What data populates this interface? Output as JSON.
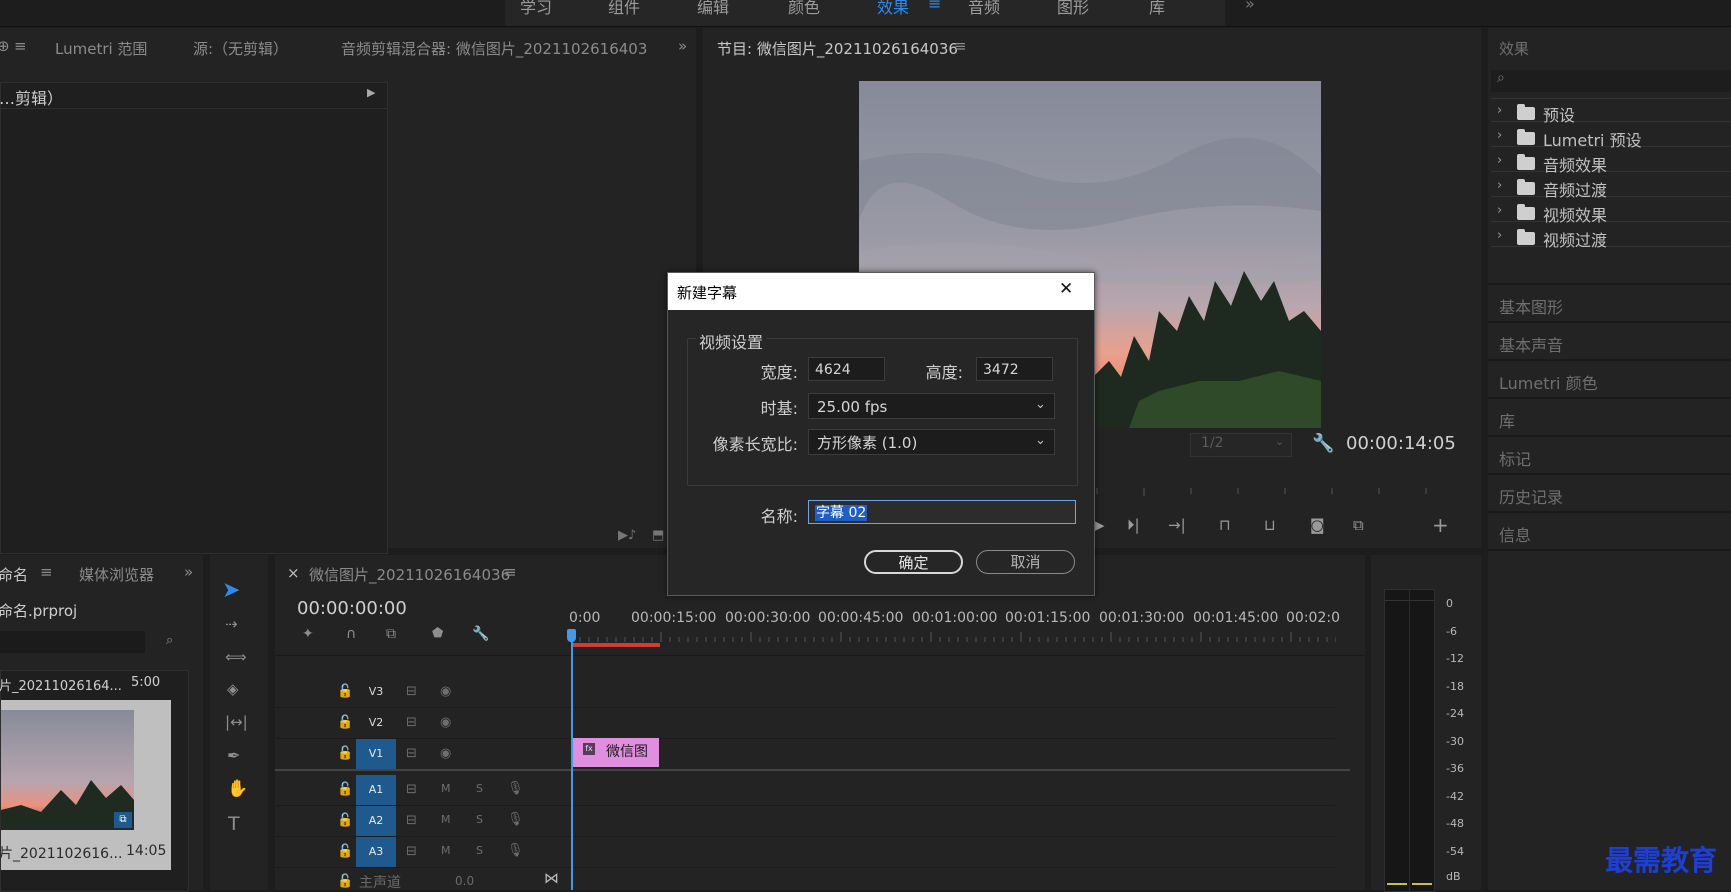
{
  "workspace_tabs": [
    "学习",
    "组件",
    "编辑",
    "颜色",
    "效果",
    "音频",
    "图形",
    "库"
  ],
  "active_workspace": "效果",
  "menu_glyph": "≡",
  "more_glyph": "»",
  "source_panel": {
    "tabs": [
      "Lumetri 范围",
      "源:（无剪辑）",
      "音频剪辑混合器: 微信图片_2021102616403"
    ],
    "left_fragment": "（无剪辑）",
    "effect_controls_fragment": "…剪辑）"
  },
  "program_panel": {
    "title": "节目: 微信图片_20211026164036",
    "zoom": "1/2",
    "timecode": "00:00:14:05"
  },
  "effects_panel": {
    "title": "效果",
    "items": [
      "预设",
      "Lumetri 预设",
      "音频效果",
      "音频过渡",
      "视频效果",
      "视频过渡"
    ],
    "side_panels": [
      "基本图形",
      "基本声音",
      "Lumetri 颜色",
      "库",
      "标记",
      "历史记录",
      "信息"
    ]
  },
  "project_panel": {
    "tabs": [
      "命名",
      "媒体浏览器"
    ],
    "project_file": "命名.prproj",
    "list_item": "片_20211026164...",
    "list_item_duration": "5:00",
    "thumb_name": "片_2021102616...",
    "thumb_duration": "14:05"
  },
  "timeline": {
    "sequence_name": "微信图片_20211026164036",
    "close_glyph": "×",
    "timecode": "00:00:00:00",
    "ruler": [
      "0:00",
      "00:00:15:00",
      "00:00:30:00",
      "00:00:45:00",
      "00:01:00:00",
      "00:01:15:00",
      "00:01:30:00",
      "00:01:45:00",
      "00:02:0"
    ],
    "video_tracks": [
      "V3",
      "V2",
      "V1"
    ],
    "audio_tracks": [
      "A1",
      "A2",
      "A3"
    ],
    "master_label": "主声道",
    "master_value": "0.0",
    "clip_label": "微信图",
    "mute_label": "M",
    "solo_label": "S"
  },
  "audio_meter": {
    "labels": [
      "0",
      "-6",
      "-12",
      "-18",
      "-24",
      "-30",
      "-36",
      "-42",
      "-48",
      "-54",
      "dB"
    ]
  },
  "dialog": {
    "title": "新建字幕",
    "close_glyph": "✕",
    "group_label": "视频设置",
    "width_label": "宽度:",
    "width_value": "4624",
    "height_label": "高度:",
    "height_value": "3472",
    "timebase_label": "时基:",
    "timebase_value": "25.00 fps",
    "par_label": "像素长宽比:",
    "par_value": "方形像素 (1.0)",
    "name_label": "名称:",
    "name_value": "字幕 02",
    "ok_label": "确定",
    "cancel_label": "取消"
  },
  "watermark": "最需教育",
  "colors": {
    "accent": "#2d8ceb",
    "clip_pink": "#e08ee0",
    "track_highlight": "#1f5a8f",
    "playhead": "#3f9bea",
    "watermark": "#1e3fd6"
  }
}
